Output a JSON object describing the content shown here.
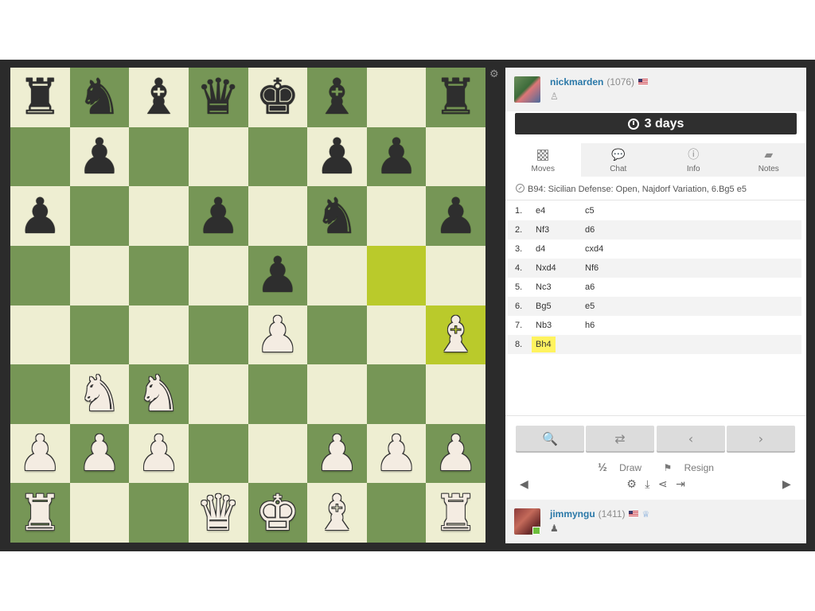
{
  "board": {
    "light_color": "#eeeed2",
    "dark_color": "#769656",
    "highlight_squares": [
      "g5",
      "h4"
    ],
    "ranks": [
      [
        "bR",
        "bN",
        "bB",
        "bQ",
        "bK",
        "bB",
        "",
        "bR"
      ],
      [
        "",
        "bP",
        "",
        "",
        "",
        "bP",
        "bP",
        ""
      ],
      [
        "bP",
        "",
        "",
        "bP",
        "",
        "bN",
        "",
        "bP"
      ],
      [
        "",
        "",
        "",
        "",
        "bP",
        "",
        "",
        ""
      ],
      [
        "",
        "",
        "",
        "",
        "wP",
        "",
        "",
        "wB"
      ],
      [
        "",
        "wN",
        "wN",
        "",
        "",
        "",
        "",
        ""
      ],
      [
        "wP",
        "wP",
        "wP",
        "",
        "",
        "wP",
        "wP",
        "wP"
      ],
      [
        "wR",
        "",
        "",
        "wQ",
        "wK",
        "wB",
        "",
        "wR"
      ]
    ],
    "settings_icon": "gear-icon"
  },
  "top_player": {
    "username": "nickmarden",
    "rating": "(1076)",
    "country": "US"
  },
  "clock": {
    "text": "3 days"
  },
  "tabs": [
    {
      "label": "Moves",
      "icon": "board-icon"
    },
    {
      "label": "Chat",
      "icon": "chat-icon"
    },
    {
      "label": "Info",
      "icon": "info-icon"
    },
    {
      "label": "Notes",
      "icon": "notes-icon"
    }
  ],
  "opening": "B94: Sicilian Defense: Open, Najdorf Variation, 6.Bg5 e5",
  "moves": [
    {
      "num": "1.",
      "white": "e4",
      "black": "c5"
    },
    {
      "num": "2.",
      "white": "Nf3",
      "black": "d6"
    },
    {
      "num": "3.",
      "white": "d4",
      "black": "cxd4"
    },
    {
      "num": "4.",
      "white": "Nxd4",
      "black": "Nf6"
    },
    {
      "num": "5.",
      "white": "Nc3",
      "black": "a6"
    },
    {
      "num": "6.",
      "white": "Bg5",
      "black": "e5"
    },
    {
      "num": "7.",
      "white": "Nb3",
      "black": "h6"
    },
    {
      "num": "8.",
      "white": "Bh4",
      "black": ""
    }
  ],
  "controls": {
    "draw_label": "Draw",
    "draw_prefix": "½",
    "resign_label": "Resign"
  },
  "bottom_player": {
    "username": "jimmyngu",
    "rating": "(1411)",
    "country": "US"
  }
}
